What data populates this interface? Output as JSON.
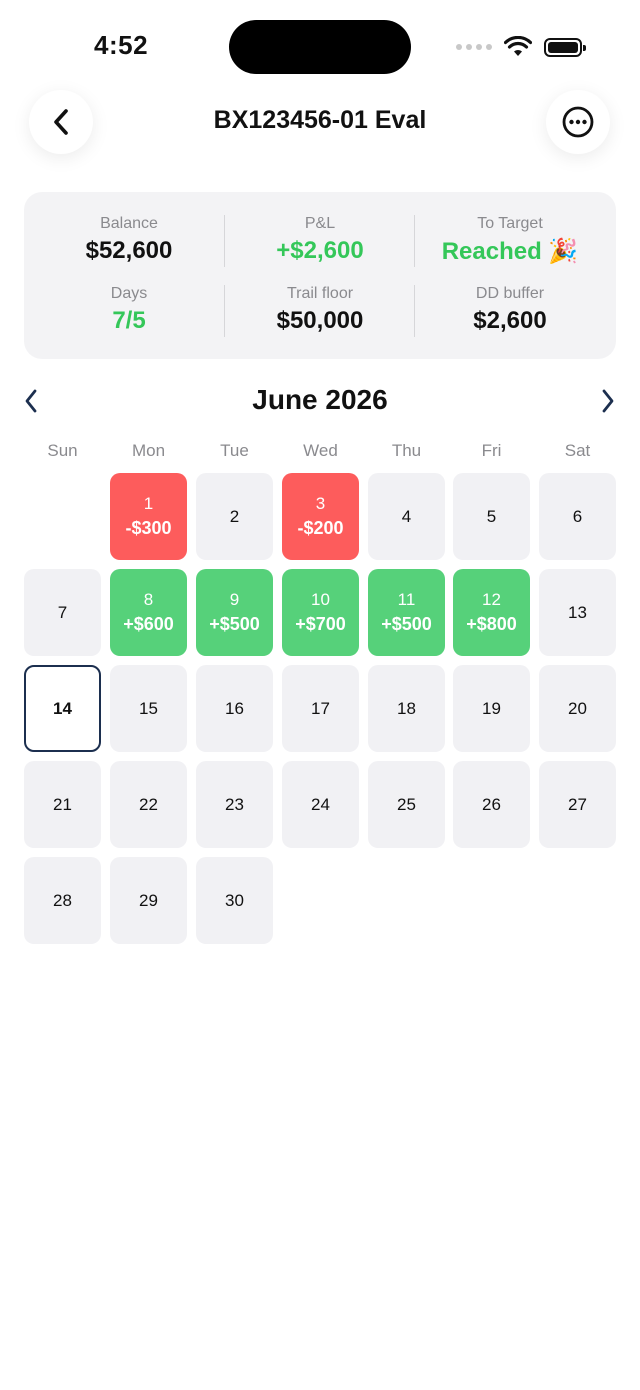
{
  "status": {
    "time": "4:52"
  },
  "header": {
    "title": "BX123456-01 Eval"
  },
  "stats": {
    "balance": {
      "label": "Balance",
      "value": "$52,600"
    },
    "pnl": {
      "label": "P&L",
      "value": "+$2,600"
    },
    "to_target": {
      "label": "To Target",
      "value": "Reached",
      "emoji": "🎉"
    },
    "days": {
      "label": "Days",
      "value": "7/5"
    },
    "trail_floor": {
      "label": "Trail floor",
      "value": "$50,000"
    },
    "dd_buffer": {
      "label": "DD buffer",
      "value": "$2,600"
    }
  },
  "calendar": {
    "month": "June 2026",
    "weekdays": [
      "Sun",
      "Mon",
      "Tue",
      "Wed",
      "Thu",
      "Fri",
      "Sat"
    ],
    "today": 14,
    "days": [
      {
        "day": "1",
        "pnl": "-$300",
        "kind": "loss"
      },
      {
        "day": "2",
        "pnl": "",
        "kind": "none"
      },
      {
        "day": "3",
        "pnl": "-$200",
        "kind": "loss"
      },
      {
        "day": "4",
        "pnl": "",
        "kind": "none"
      },
      {
        "day": "5",
        "pnl": "",
        "kind": "none"
      },
      {
        "day": "6",
        "pnl": "",
        "kind": "none"
      },
      {
        "day": "7",
        "pnl": "",
        "kind": "none"
      },
      {
        "day": "8",
        "pnl": "+$600",
        "kind": "gain"
      },
      {
        "day": "9",
        "pnl": "+$500",
        "kind": "gain"
      },
      {
        "day": "10",
        "pnl": "+$700",
        "kind": "gain"
      },
      {
        "day": "11",
        "pnl": "+$500",
        "kind": "gain"
      },
      {
        "day": "12",
        "pnl": "+$800",
        "kind": "gain"
      },
      {
        "day": "13",
        "pnl": "",
        "kind": "none"
      },
      {
        "day": "14",
        "pnl": "",
        "kind": "today"
      },
      {
        "day": "15",
        "pnl": "",
        "kind": "none"
      },
      {
        "day": "16",
        "pnl": "",
        "kind": "none"
      },
      {
        "day": "17",
        "pnl": "",
        "kind": "none"
      },
      {
        "day": "18",
        "pnl": "",
        "kind": "none"
      },
      {
        "day": "19",
        "pnl": "",
        "kind": "none"
      },
      {
        "day": "20",
        "pnl": "",
        "kind": "none"
      },
      {
        "day": "21",
        "pnl": "",
        "kind": "none"
      },
      {
        "day": "22",
        "pnl": "",
        "kind": "none"
      },
      {
        "day": "23",
        "pnl": "",
        "kind": "none"
      },
      {
        "day": "24",
        "pnl": "",
        "kind": "none"
      },
      {
        "day": "25",
        "pnl": "",
        "kind": "none"
      },
      {
        "day": "26",
        "pnl": "",
        "kind": "none"
      },
      {
        "day": "27",
        "pnl": "",
        "kind": "none"
      },
      {
        "day": "28",
        "pnl": "",
        "kind": "none"
      },
      {
        "day": "29",
        "pnl": "",
        "kind": "none"
      },
      {
        "day": "30",
        "pnl": "",
        "kind": "none"
      }
    ]
  },
  "colors": {
    "gain": "#56d17a",
    "loss": "#fd5c5c",
    "accent_green": "#34c759",
    "today_border": "#1c2f4f"
  },
  "icons": {
    "back": "chevron-left-icon",
    "more": "ellipsis-circle-icon",
    "prev": "chevron-left-icon",
    "next": "chevron-right-icon"
  }
}
